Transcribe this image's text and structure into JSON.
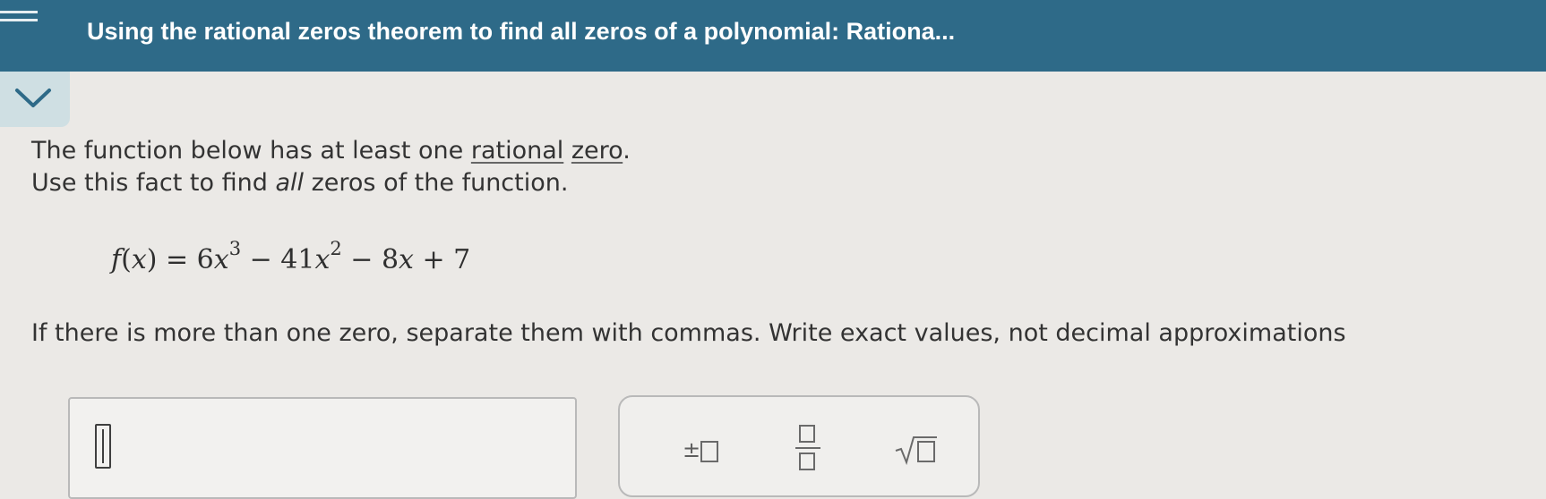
{
  "header": {
    "title": "Using the rational zeros theorem to find all zeros of a polynomial: Rationa..."
  },
  "icons": {
    "menu": "menu-icon",
    "collapse": "chevron-down-icon",
    "plus_minus": "plus-minus-icon",
    "fraction": "fraction-icon",
    "square_root": "square-root-icon"
  },
  "problem": {
    "line1_prefix": "The function below has at least one ",
    "line1_link1": "rational",
    "line1_space": " ",
    "line1_link2": "zero",
    "line1_suffix": ".",
    "line2_prefix": "Use this fact to find ",
    "line2_emphasis": "all",
    "line2_suffix": " zeros of the function.",
    "formula": {
      "f": "f",
      "open": "(",
      "x": "x",
      "close": ")",
      "eq": " = 6",
      "x1": "x",
      "exp1": "3",
      "mid": " − 41",
      "x2": "x",
      "exp2": "2",
      "end_coef": " − 8",
      "x3": "x",
      "end": " + 7"
    },
    "instruction": "If there is more than one zero, separate them with commas. Write exact values, not decimal approximations"
  },
  "answer": {
    "value": ""
  },
  "toolbar": {
    "plus_minus_symbol": "±"
  },
  "colors": {
    "header_bg": "#2e6a88",
    "page_bg": "#ebe9e6",
    "tab_bg": "#cfdfe3"
  }
}
